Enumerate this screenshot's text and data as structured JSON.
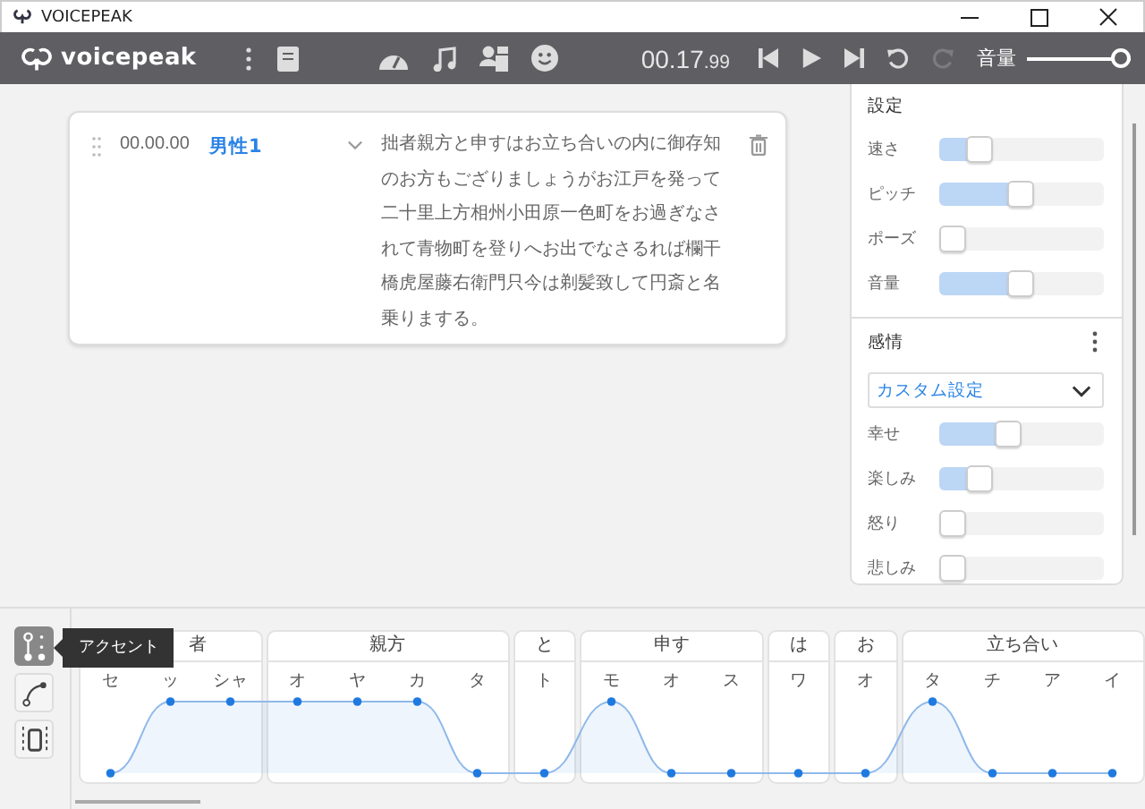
{
  "window": {
    "title": "VOICEPEAK"
  },
  "toolbar": {
    "app_name": "voicepeak",
    "time": "00.17",
    "time_fraction": ".99",
    "undo_disabled": false,
    "redo_disabled": true,
    "volume_label": "音量",
    "volume": {
      "level": 1.0
    }
  },
  "blocks": [
    {
      "time": "00.00.00",
      "narrator": "男性1",
      "text": "拙者親方と申すはお立ち合いの内に御存知のお方もござりましょうがお江戸を発って二十里上方相州小田原一色町をお過ぎなされて青物町を登りへお出でなさるれば欄干橋虎屋藤右衛門只今は剃髪致して円斎と名乗りまする。"
    }
  ],
  "settings": {
    "title": "設定",
    "sliders": [
      {
        "label": "速さ",
        "level": 0.2
      },
      {
        "label": "ピッチ",
        "level": 0.5
      },
      {
        "label": "ポーズ",
        "level": 0
      },
      {
        "label": "音量",
        "level": 0.5
      }
    ]
  },
  "emotion": {
    "title": "感情",
    "preset": "カスタム設定",
    "sliders": [
      {
        "label": "幸せ",
        "level": 0.4
      },
      {
        "label": "楽しみ",
        "level": 0.2
      },
      {
        "label": "怒り",
        "level": 0
      },
      {
        "label": "悲しみ",
        "level": 0
      }
    ]
  },
  "tools": [
    {
      "kind": "accent",
      "selected": true
    },
    {
      "kind": "curve",
      "selected": false
    },
    {
      "kind": "length",
      "selected": false
    }
  ],
  "tooltip": "アクセント",
  "words": [
    {
      "word": "者",
      "moras": [
        {
          "kana": "セ",
          "high": false
        },
        {
          "kana": "ッ",
          "high": true
        },
        {
          "kana": "シャ",
          "high": true
        }
      ]
    },
    {
      "word": "親方",
      "moras": [
        {
          "kana": "オ",
          "high": true
        },
        {
          "kana": "ヤ",
          "high": true
        },
        {
          "kana": "カ",
          "high": true
        },
        {
          "kana": "タ",
          "high": false
        }
      ]
    },
    {
      "word": "と",
      "moras": [
        {
          "kana": "ト",
          "high": false
        }
      ]
    },
    {
      "word": "申す",
      "moras": [
        {
          "kana": "モ",
          "high": true
        },
        {
          "kana": "オ",
          "high": false
        },
        {
          "kana": "ス",
          "high": false
        }
      ]
    },
    {
      "word": "は",
      "moras": [
        {
          "kana": "ワ",
          "high": false
        }
      ]
    },
    {
      "word": "お",
      "moras": [
        {
          "kana": "オ",
          "high": false
        }
      ]
    },
    {
      "word": "立ち合い",
      "moras": [
        {
          "kana": "タ",
          "high": true
        },
        {
          "kana": "チ",
          "high": false
        },
        {
          "kana": "ア",
          "high": false
        },
        {
          "kana": "イ",
          "high": false
        }
      ]
    }
  ]
}
